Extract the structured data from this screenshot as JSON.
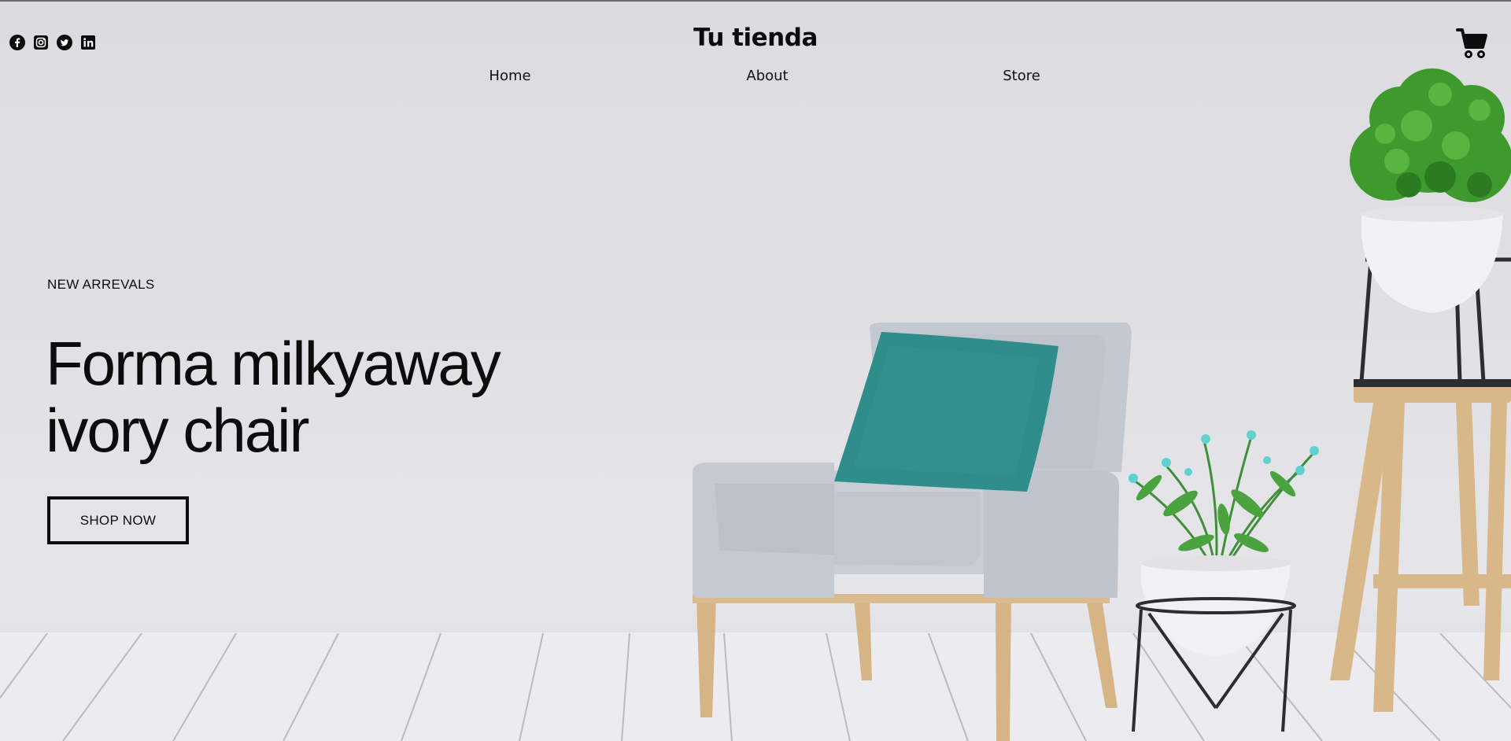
{
  "brand": {
    "name": "Tu tienda"
  },
  "social": [
    {
      "name": "facebook-icon"
    },
    {
      "name": "instagram-icon"
    },
    {
      "name": "twitter-icon"
    },
    {
      "name": "linkedin-icon"
    }
  ],
  "nav": {
    "items": [
      "Home",
      "About",
      "Store"
    ]
  },
  "cart": {
    "icon": "cart-icon"
  },
  "hero": {
    "kicker": "NEW ARREVALS",
    "title_line1": "Forma milkyaway",
    "title_line2": "ivory chair",
    "cta": "SHOP NOW"
  },
  "colors": {
    "text": "#0c0c0c",
    "wall": "#dfdfe3",
    "cushion": "#2f8e8b",
    "chair": "#c8ccd3",
    "wood": "#d8b888"
  }
}
